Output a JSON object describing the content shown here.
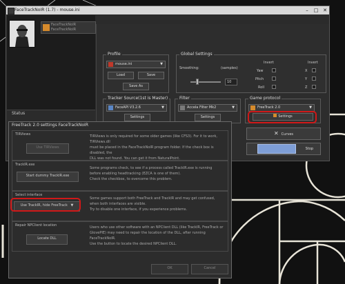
{
  "main_window": {
    "title": "FaceTrackNoIR (1.7) - mouse.ini",
    "logo_line1": "FaceTrackNoIR",
    "logo_line2": "FaceTrackNoIR",
    "status_label": "Status",
    "profile": {
      "title": "Profile",
      "selected": "mouse.ini",
      "load_label": "Load",
      "save_label": "Save",
      "save_as_label": "Save As"
    },
    "global_settings": {
      "title": "Global Settings",
      "smoothing_label": "Smoothing:",
      "samples_label": "(samples)",
      "smoothing_value": "10",
      "invert_header_left": "Invert",
      "invert_header_right": "Invert",
      "yaw_label": "Yaw",
      "pitch_label": "Pitch",
      "roll_label": "Roll",
      "x_label": "X",
      "y_label": "Y",
      "z_label": "Z"
    },
    "tracker": {
      "title": "Tracker Source(1st is Master)",
      "selected": "FaceAPI V3.2.6",
      "settings_label": "Settings"
    },
    "filter": {
      "title": "Filter",
      "selected": "Accela Filter Mk2",
      "settings_label": "Settings"
    },
    "game_protocol": {
      "title": "Game protocol",
      "selected": "FreeTrack 2.0",
      "settings_label": "Settings"
    },
    "curves_label": "Curves",
    "stop_label": "Stop"
  },
  "settings_dialog": {
    "title": "FreeTrack 2.0 settings FaceTrackNoIR",
    "sections": [
      {
        "title": "TIRViews",
        "button": "Use TIRViews",
        "lines": [
          "TIRViews is only required for some older games (like CFS3). For it to work, TIRViews.dll",
          "must be placed in the FaceTrackNoIR program folder. If the check box is disabled, the",
          "DLL was not found. You can get it from NaturalPoint."
        ]
      },
      {
        "title": "TrackIR.exe",
        "button": "Start dummy TrackIR.exe",
        "lines": [
          "Some programs check, to see if a process called TrackIR.exe is running",
          "before enabling headtracking (EZCA is one of them).",
          "Check the checkbox, to overcome this problem."
        ]
      },
      {
        "title": "Select interface",
        "button": "Use TrackIR, hide FreeTrack",
        "lines": [
          "Some games support both FreeTrack and TrackIR and may get confused,",
          "when both interfaces are visible.",
          "Try to disable one interface, if you experience problems."
        ]
      },
      {
        "title": "Repair NPClient location",
        "button": "Locate DLL",
        "lines": [
          "Users who use other software with an NPClient DLL (like TrackIR, FreeTrack or",
          "GlovePIE) may need to repair the location of the DLL, after running FaceTrackNoIR.",
          "Use the button to locate the desired NPClient DLL."
        ]
      }
    ],
    "ok_label": "OK",
    "cancel_label": "Cancel"
  },
  "colors": {
    "highlight": "#d11818",
    "desktop_bg": "#111111",
    "spiral": "#e8e4d8"
  }
}
